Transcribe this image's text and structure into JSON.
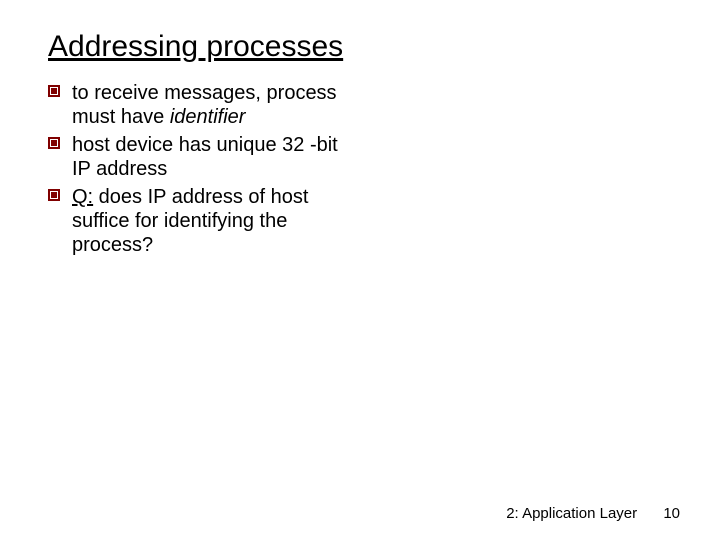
{
  "title": "Addressing processes",
  "bullets": {
    "b1_a": "to receive messages, process  must have ",
    "b1_ital": "identifier",
    "b2": "host device has unique 32 -bit IP address",
    "b3_q": "Q:",
    "b3_rest": " does  IP address of host suffice for identifying the process?"
  },
  "footer": {
    "chapter": "2: Application Layer",
    "page": "10"
  }
}
